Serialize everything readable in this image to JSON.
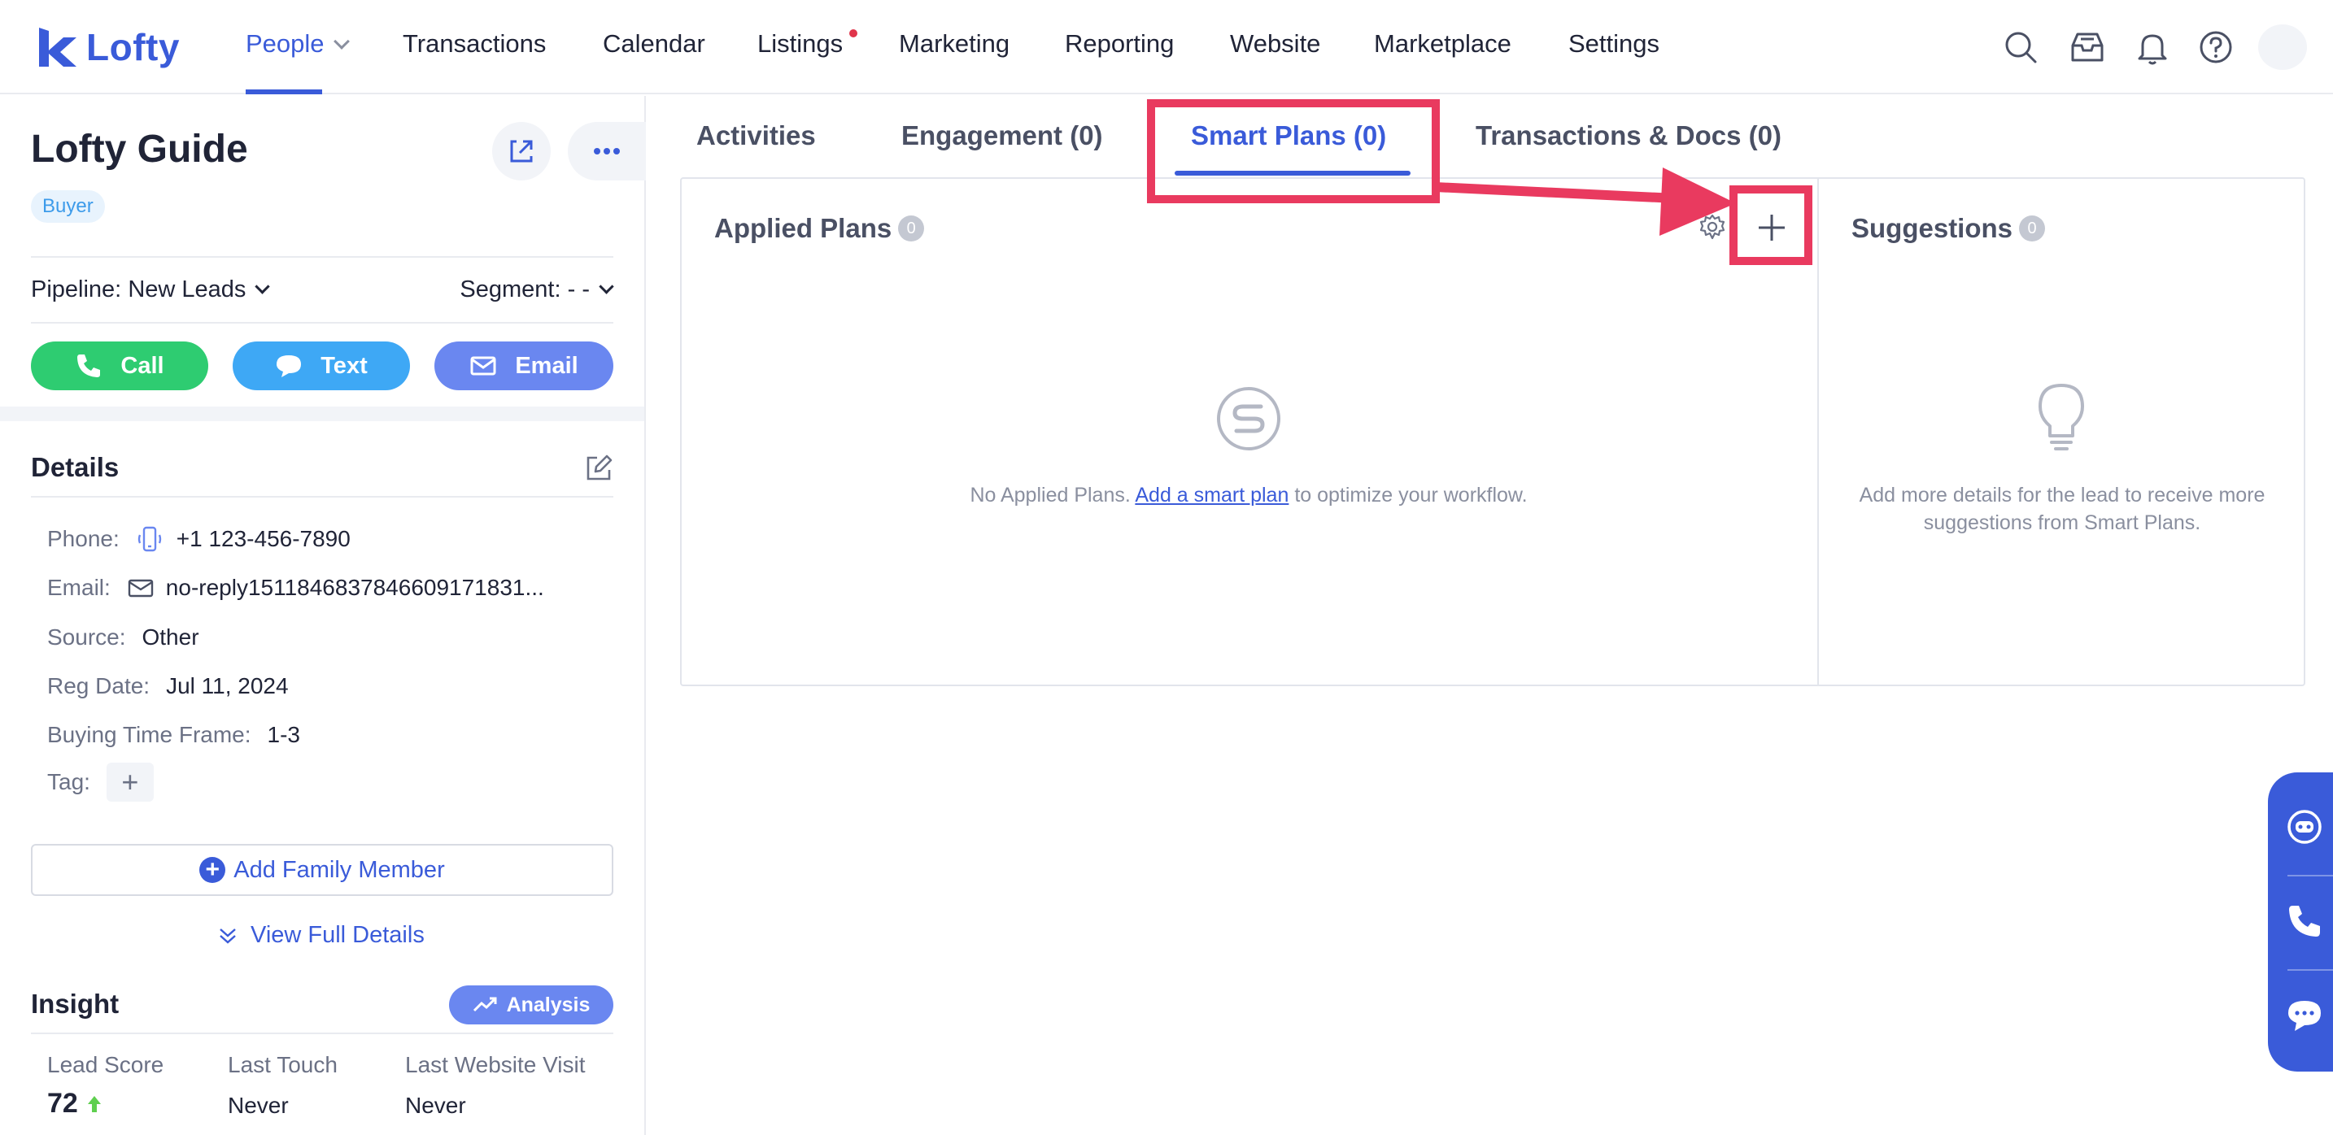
{
  "brand": {
    "name": "Lofty",
    "accent": "#3a5bd9"
  },
  "nav": {
    "items": [
      {
        "label": "People",
        "active": true,
        "dropdown": true
      },
      {
        "label": "Transactions"
      },
      {
        "label": "Calendar"
      },
      {
        "label": "Listings",
        "notification_dot": true
      },
      {
        "label": "Marketing"
      },
      {
        "label": "Reporting"
      },
      {
        "label": "Website"
      },
      {
        "label": "Marketplace"
      },
      {
        "label": "Settings"
      }
    ],
    "icons": [
      "search-icon",
      "inbox-icon",
      "bell-icon",
      "help-icon",
      "avatar"
    ]
  },
  "lead": {
    "name": "Lofty Guide",
    "type_badge": "Buyer",
    "pipeline_label": "Pipeline:",
    "pipeline_value": "New Leads",
    "segment_label": "Segment:",
    "segment_value": "- -",
    "actions": {
      "call": "Call",
      "text": "Text",
      "email": "Email"
    }
  },
  "details": {
    "title": "Details",
    "phone_label": "Phone:",
    "phone": "+1 123-456-7890",
    "email_label": "Email:",
    "email": "no-reply15118468378466091718​31...",
    "source_label": "Source:",
    "source": "Other",
    "reg_date_label": "Reg Date:",
    "reg_date": "Jul 11, 2024",
    "timeframe_label": "Buying Time Frame:",
    "timeframe": "1-3",
    "tag_label": "Tag:",
    "add_family": "Add Family Member",
    "view_full": "View Full Details"
  },
  "insight": {
    "title": "Insight",
    "analysis": "Analysis",
    "lead_score_label": "Lead Score",
    "lead_score": "72",
    "last_touch_label": "Last Touch",
    "last_touch": "Never",
    "last_visit_label": "Last Website Visit",
    "last_visit": "Never"
  },
  "tabs": [
    {
      "label": "Activities"
    },
    {
      "label": "Engagement (0)"
    },
    {
      "label": "Smart Plans (0)",
      "active": true
    },
    {
      "label": "Transactions & Docs (0)"
    }
  ],
  "applied_plans": {
    "title": "Applied Plans",
    "count": "0",
    "empty_prefix": "No Applied Plans. ",
    "empty_link": "Add a smart plan",
    "empty_suffix": " to optimize your workflow."
  },
  "suggestions": {
    "title": "Suggestions",
    "count": "0",
    "empty": "Add more details for the lead to receive more suggestions from Smart Plans."
  },
  "colors": {
    "call": "#2ecc71",
    "text": "#3ea8f5",
    "email": "#6a87f0",
    "annotation": "#e93a5f",
    "score": "#5fcf4f"
  }
}
